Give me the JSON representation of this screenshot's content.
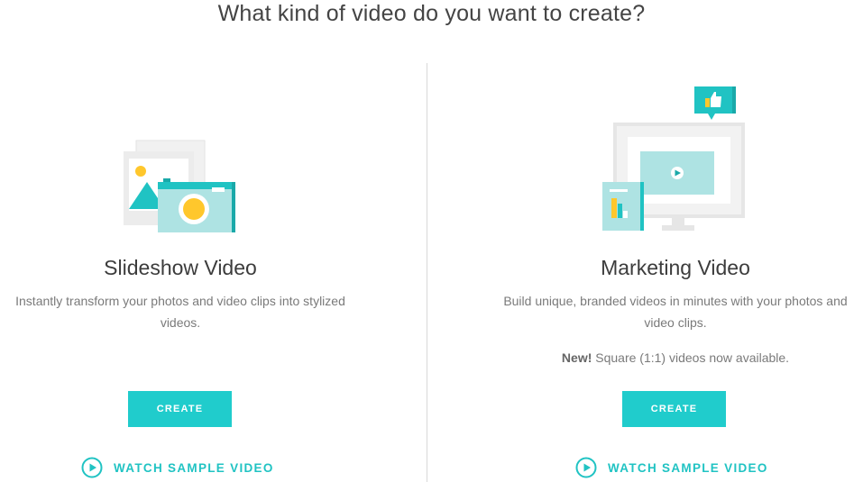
{
  "header": {
    "title": "What kind of video do you want to create?"
  },
  "cards": [
    {
      "title": "Slideshow Video",
      "description_line1": "Instantly transform your photos and video clips into stylized",
      "description_line2": "videos.",
      "note_bold": "",
      "note_text": "",
      "create_label": "CREATE",
      "watch_label": "WATCH SAMPLE VIDEO",
      "icon": "photos-camera-illustration"
    },
    {
      "title": "Marketing Video",
      "description_line1": "Build unique, branded videos in minutes with your photos and",
      "description_line2": "video clips.",
      "note_bold": "New!",
      "note_text": " Square (1:1) videos now available.",
      "create_label": "CREATE",
      "watch_label": "WATCH SAMPLE VIDEO",
      "icon": "monitor-marketing-illustration"
    }
  ],
  "colors": {
    "accent": "#20cccc",
    "accent_text": "#20c3c3",
    "title_text": "#444444",
    "body_text": "#7a7a7a",
    "divider": "#d9d9d9"
  }
}
